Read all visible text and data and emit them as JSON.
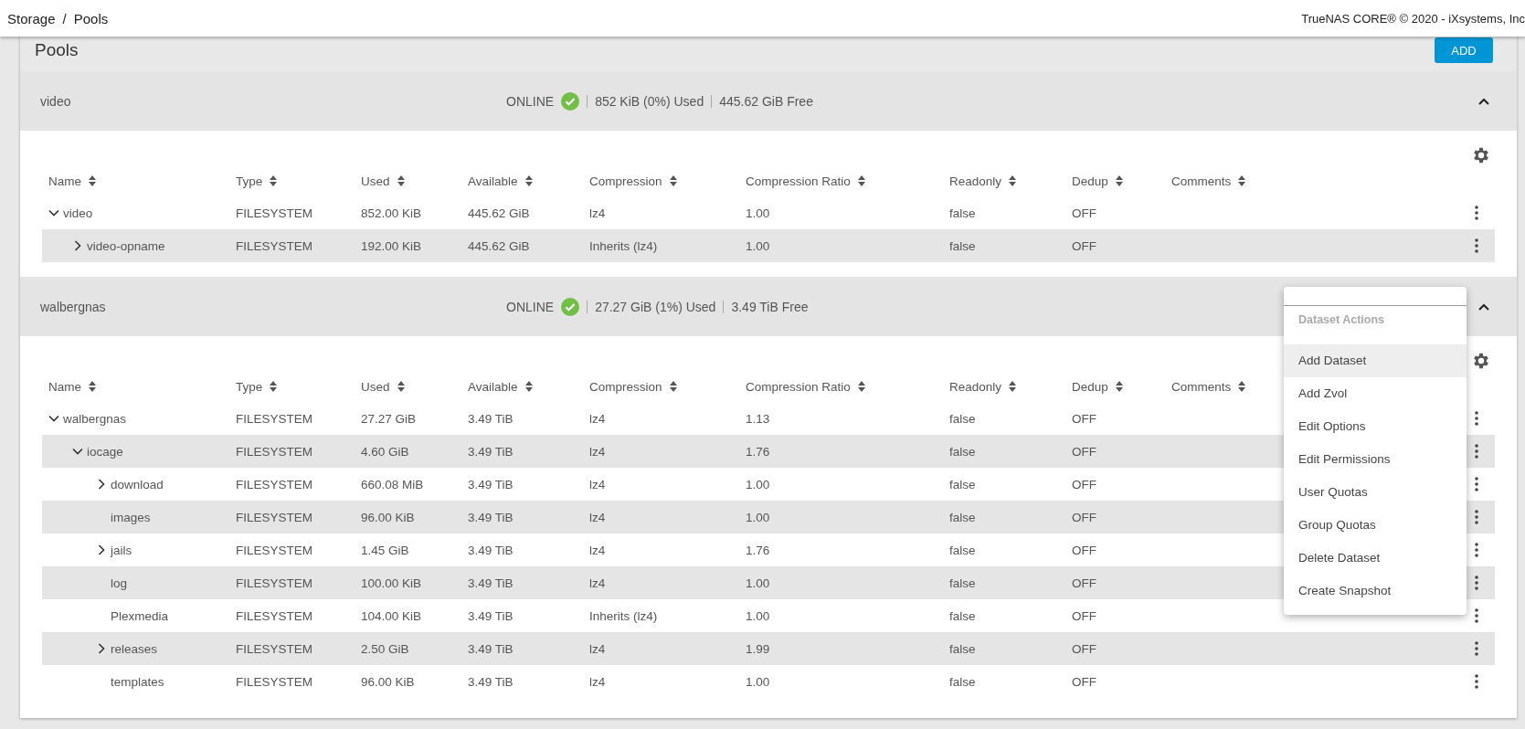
{
  "breadcrumb": [
    "Storage",
    "Pools"
  ],
  "breadcrumb_separator": "/",
  "copyright": "TrueNAS CORE® © 2020 - iXsystems, Inc",
  "title": "Pools",
  "add_button": "ADD",
  "pools": [
    {
      "name": "video",
      "status": "ONLINE",
      "healthy": true,
      "used": "852 KiB (0%) Used",
      "free": "445.62 GiB Free",
      "expanded": true,
      "columns": [
        "Name",
        "Type",
        "Used",
        "Available",
        "Compression",
        "Compression Ratio",
        "Readonly",
        "Dedup",
        "Comments"
      ],
      "datasets": [
        {
          "name": "video",
          "type": "FILESYSTEM",
          "used": "852.00 KiB",
          "available": "445.62 GiB",
          "compression": "lz4",
          "ratio": "1.00",
          "readonly": "false",
          "dedup": "OFF",
          "expanded": true,
          "children": [
            {
              "name": "video-opname",
              "type": "FILESYSTEM",
              "used": "192.00 KiB",
              "available": "445.62 GiB",
              "compression": "Inherits (lz4)",
              "ratio": "1.00",
              "readonly": "false",
              "dedup": "OFF",
              "expanded": false
            }
          ]
        }
      ]
    },
    {
      "name": "walbergnas",
      "status": "ONLINE",
      "healthy": true,
      "used": "27.27 GiB (1%) Used",
      "free": "3.49 TiB Free",
      "expanded": true,
      "columns": [
        "Name",
        "Type",
        "Used",
        "Available",
        "Compression",
        "Compression Ratio",
        "Readonly",
        "Dedup",
        "Comments"
      ],
      "datasets": [
        {
          "name": "walbergnas",
          "type": "FILESYSTEM",
          "used": "27.27 GiB",
          "available": "3.49 TiB",
          "compression": "lz4",
          "ratio": "1.13",
          "readonly": "false",
          "dedup": "OFF",
          "expanded": true,
          "children": [
            {
              "name": "iocage",
              "type": "FILESYSTEM",
              "used": "4.60 GiB",
              "available": "3.49 TiB",
              "compression": "lz4",
              "ratio": "1.76",
              "readonly": "false",
              "dedup": "OFF",
              "expanded": true,
              "children": [
                {
                  "name": "download",
                  "type": "FILESYSTEM",
                  "used": "660.08 MiB",
                  "available": "3.49 TiB",
                  "compression": "lz4",
                  "ratio": "1.00",
                  "readonly": "false",
                  "dedup": "OFF",
                  "expanded": false
                },
                {
                  "name": "images",
                  "type": "FILESYSTEM",
                  "used": "96.00 KiB",
                  "available": "3.49 TiB",
                  "compression": "lz4",
                  "ratio": "1.00",
                  "readonly": "false",
                  "dedup": "OFF"
                },
                {
                  "name": "jails",
                  "type": "FILESYSTEM",
                  "used": "1.45 GiB",
                  "available": "3.49 TiB",
                  "compression": "lz4",
                  "ratio": "1.76",
                  "readonly": "false",
                  "dedup": "OFF",
                  "expanded": false
                },
                {
                  "name": "log",
                  "type": "FILESYSTEM",
                  "used": "100.00 KiB",
                  "available": "3.49 TiB",
                  "compression": "lz4",
                  "ratio": "1.00",
                  "readonly": "false",
                  "dedup": "OFF"
                },
                {
                  "name": "Plexmedia",
                  "type": "FILESYSTEM",
                  "used": "104.00 KiB",
                  "available": "3.49 TiB",
                  "compression": "Inherits (lz4)",
                  "ratio": "1.00",
                  "readonly": "false",
                  "dedup": "OFF"
                },
                {
                  "name": "releases",
                  "type": "FILESYSTEM",
                  "used": "2.50 GiB",
                  "available": "3.49 TiB",
                  "compression": "lz4",
                  "ratio": "1.99",
                  "readonly": "false",
                  "dedup": "OFF",
                  "expanded": false
                },
                {
                  "name": "templates",
                  "type": "FILESYSTEM",
                  "used": "96.00 KiB",
                  "available": "3.49 TiB",
                  "compression": "lz4",
                  "ratio": "1.00",
                  "readonly": "false",
                  "dedup": "OFF"
                }
              ]
            }
          ]
        }
      ]
    }
  ],
  "menu": {
    "title": "Dataset Actions",
    "items": [
      {
        "label": "Add Dataset",
        "selected": true
      },
      {
        "label": "Add Zvol",
        "selected": false
      },
      {
        "label": "Edit Options",
        "selected": false
      },
      {
        "label": "Edit Permissions",
        "selected": false
      },
      {
        "label": "User Quotas",
        "selected": false
      },
      {
        "label": "Group Quotas",
        "selected": false
      },
      {
        "label": "Delete Dataset",
        "selected": false
      },
      {
        "label": "Create Snapshot",
        "selected": false
      }
    ]
  }
}
